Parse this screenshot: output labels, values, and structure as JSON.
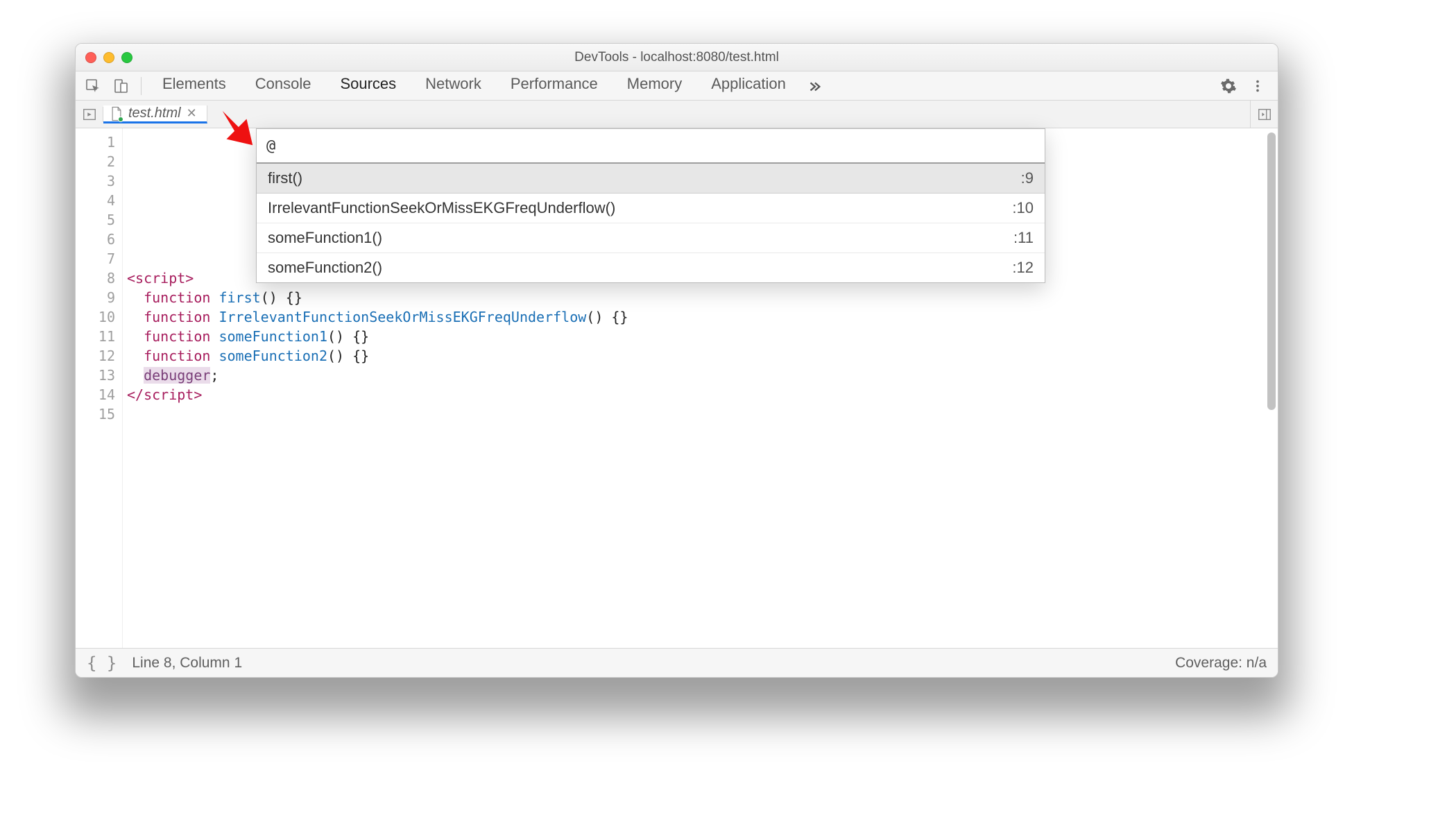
{
  "window": {
    "title": "DevTools - localhost:8080/test.html"
  },
  "toolbar": {
    "tabs": [
      {
        "label": "Elements"
      },
      {
        "label": "Console"
      },
      {
        "label": "Sources"
      },
      {
        "label": "Network"
      },
      {
        "label": "Performance"
      },
      {
        "label": "Memory"
      },
      {
        "label": "Application"
      }
    ],
    "active_tab_index": 2
  },
  "file_tab": {
    "name": "test.html"
  },
  "quick_open": {
    "query": "@",
    "results": [
      {
        "name": "first()",
        "location": ":9"
      },
      {
        "name": "IrrelevantFunctionSeekOrMissEKGFreqUnderflow()",
        "location": ":10"
      },
      {
        "name": "someFunction1()",
        "location": ":11"
      },
      {
        "name": "someFunction2()",
        "location": ":12"
      }
    ],
    "selected_index": 0
  },
  "editor": {
    "line_count": 15,
    "lines": [
      {
        "n": 1,
        "html": ""
      },
      {
        "n": 2,
        "html": ""
      },
      {
        "n": 3,
        "html": ""
      },
      {
        "n": 4,
        "html": ""
      },
      {
        "n": 5,
        "html": ""
      },
      {
        "n": 6,
        "html": ""
      },
      {
        "n": 7,
        "html": ""
      },
      {
        "n": 8,
        "html": "<span class='tag'>&lt;script&gt;</span>"
      },
      {
        "n": 9,
        "html": "  <span class='kw'>function</span> <span class='fn'>first</span>() {}"
      },
      {
        "n": 10,
        "html": "  <span class='kw'>function</span> <span class='fn'>IrrelevantFunctionSeekOrMissEKGFreqUnderflow</span>() {}"
      },
      {
        "n": 11,
        "html": "  <span class='kw'>function</span> <span class='fn'>someFunction1</span>() {}"
      },
      {
        "n": 12,
        "html": "  <span class='kw'>function</span> <span class='fn'>someFunction2</span>() {}"
      },
      {
        "n": 13,
        "html": "  <span class='dbg'>debugger</span>;"
      },
      {
        "n": 14,
        "html": "<span class='tag'>&lt;/script&gt;</span>"
      },
      {
        "n": 15,
        "html": ""
      }
    ]
  },
  "status": {
    "cursor": "Line 8, Column 1",
    "coverage": "Coverage: n/a"
  }
}
